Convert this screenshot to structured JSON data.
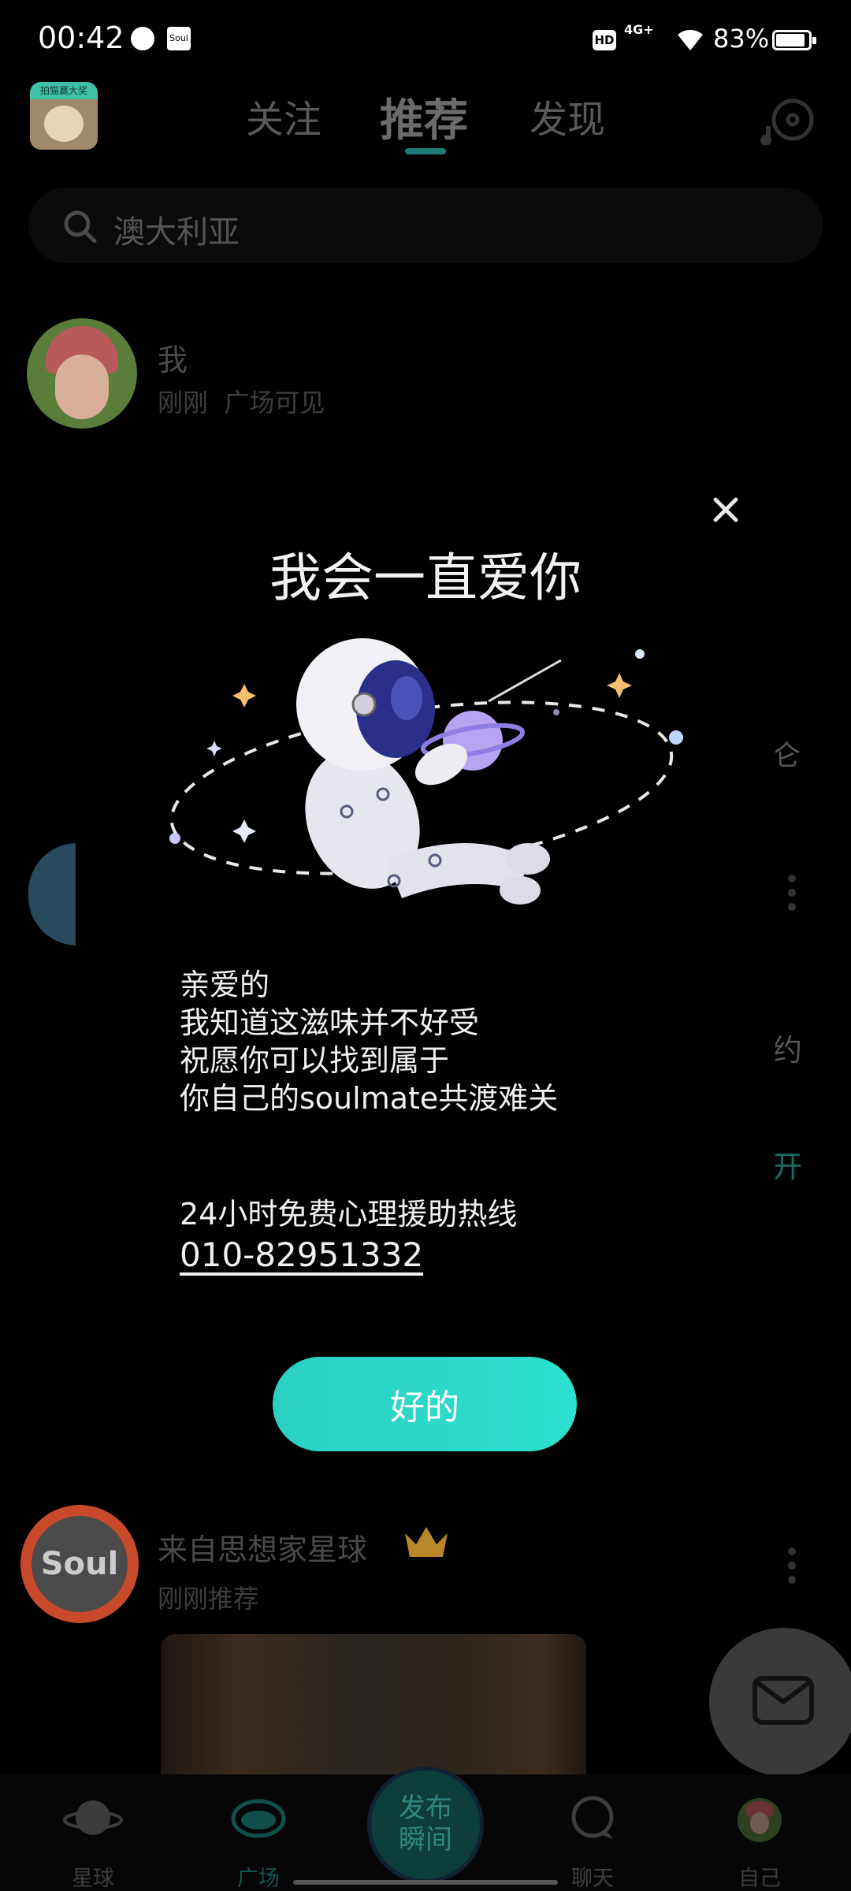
{
  "status_bar": {
    "time": "00:42",
    "hd": "HD",
    "network": "4G+",
    "battery": "83%",
    "battery_level": 0.83,
    "soul_mini": "Soul"
  },
  "header": {
    "avatar_tag": "拍猫赢大奖",
    "tabs": [
      {
        "label": "关注",
        "active": false
      },
      {
        "label": "推荐",
        "active": true
      },
      {
        "label": "发现",
        "active": false
      }
    ]
  },
  "search": {
    "placeholder": "澳大利亚"
  },
  "feed": {
    "post1": {
      "name": "我",
      "time": "刚刚",
      "visibility": "广场可见"
    },
    "side_fragments": [
      "仑",
      "约",
      "开"
    ],
    "post2": {
      "name": "来自思想家星球",
      "meta": "刚刚推荐",
      "avatar_text": "Soul"
    }
  },
  "modal": {
    "title": "我会一直爱你",
    "message_lines": [
      "亲爱的",
      "我知道这滋味并不好受",
      "祝愿你可以找到属于",
      "你自己的soulmate共渡难关"
    ],
    "hotline_label": "24小时免费心理援助热线",
    "hotline_number": "010-82951332",
    "ok_button": "好的"
  },
  "bottom_nav": {
    "items": [
      {
        "label": "星球",
        "icon": "planet-icon"
      },
      {
        "label": "广场",
        "icon": "eye-icon",
        "active": true
      },
      {
        "label": "聊天",
        "icon": "chat-bubble-icon"
      },
      {
        "label": "自己",
        "icon": "avatar"
      }
    ],
    "publish": "发布瞬间"
  },
  "colors": {
    "accent": "#2ed6c6",
    "background": "#000000"
  }
}
